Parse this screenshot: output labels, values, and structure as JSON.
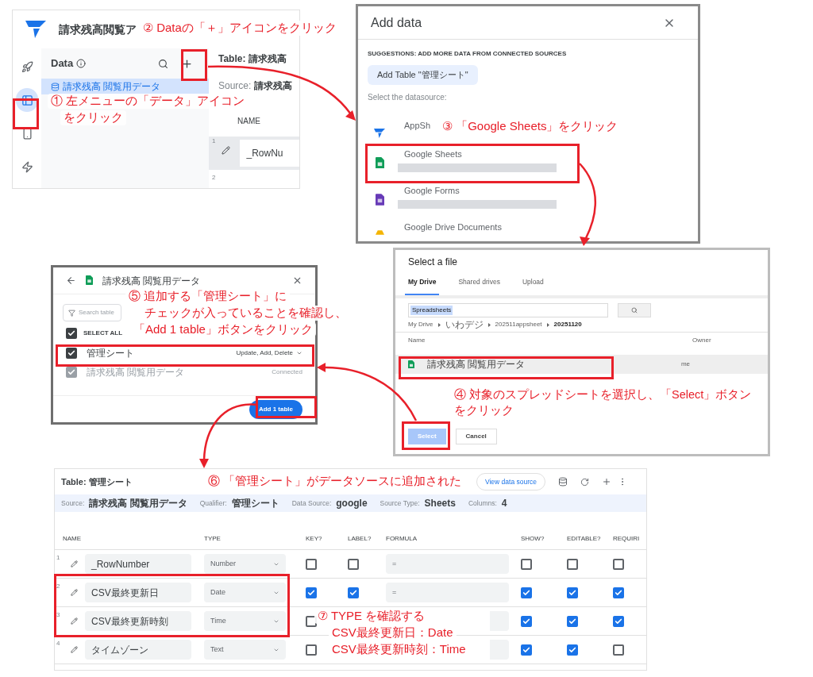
{
  "app_panel": {
    "title": "請求残高閲覧ア",
    "nav_items": [
      {
        "selected": false
      },
      {
        "selected": true
      },
      {
        "selected": false
      },
      {
        "selected": false
      }
    ],
    "data_heading": "Data",
    "data_items": [
      {
        "label": "請求残高 閲覧用データ",
        "selected": true
      }
    ],
    "table_title": "Table: 請求残高",
    "source_label": "Source:",
    "source_value": "請求残高",
    "column": "NAME",
    "rows": [
      {
        "number": "1",
        "name": "_RowNu"
      },
      {
        "number": "2"
      }
    ],
    "callouts": [
      {
        "lines": [
          "① 左メニューの「データ」アイコン",
          "をクリック"
        ]
      },
      {
        "lines": [
          "② Dataの「＋」アイコンをクリック"
        ]
      }
    ]
  },
  "add_data_dialog": {
    "title": "Add data",
    "suggestions_heading": "SUGGESTIONS: ADD MORE DATA FROM CONNECTED SOURCES",
    "suggestion_chip": "Add Table \"管理シート\"",
    "select_label": "Select the datasource:",
    "sources": [
      {
        "kind": "appsheet",
        "label": "AppSh"
      },
      {
        "kind": "sheets",
        "label": "Google Sheets"
      },
      {
        "kind": "forms",
        "label": "Google Forms"
      },
      {
        "kind": "docs",
        "label": "Google Drive Documents"
      }
    ],
    "callout": {
      "lines": [
        "③ 「Google Sheets」をクリック"
      ]
    }
  },
  "tables_dialog": {
    "title": "請求残高 閲覧用データ",
    "search_placeholder": "Search table",
    "select_all": {
      "label": "SELECT ALL",
      "checked": true
    },
    "tables": [
      {
        "name": "管理シート",
        "checked": true,
        "disabled": false,
        "access": "Update, Add, Delete"
      },
      {
        "name": "請求残高 閲覧用データ",
        "checked": true,
        "disabled": true,
        "access": "Connected"
      }
    ],
    "add_button": "Add 1 table",
    "callout": {
      "lines": [
        "⑤ 追加する「管理シート」に",
        "チェックが入っていることを確認し、",
        "「Add 1 table」ボタンをクリック"
      ]
    }
  },
  "file_picker": {
    "title": "Select a file",
    "tabs": [
      {
        "label": "My Drive",
        "selected": true
      },
      {
        "label": "Shared drives",
        "selected": false
      },
      {
        "label": "Upload",
        "selected": false
      }
    ],
    "search_value": "Spreadsheets",
    "breadcrumb": [
      "My Drive",
      "いわデジ",
      "202511appsheet",
      "20251120"
    ],
    "columns": [
      "Name",
      "Owner"
    ],
    "files": [
      {
        "name": "請求残高 閲覧用データ",
        "owner": "me",
        "selected": true
      }
    ],
    "buttons": [
      {
        "label": "Select",
        "disabled": true
      },
      {
        "label": "Cancel",
        "disabled": false
      }
    ],
    "callout": {
      "lines": [
        "④ 対象のスプレッドシートを選択し、「Select」ボタン",
        "をクリック"
      ]
    }
  },
  "table_editor": {
    "title": "Table: 管理シート",
    "view_button": "View data source",
    "info": [
      {
        "label": "Source:",
        "value": "請求残高 閲覧用データ"
      },
      {
        "label": "Qualifier:",
        "value": "管理シート"
      },
      {
        "label": "Data Source:",
        "value": "google"
      },
      {
        "label": "Source Type:",
        "value": "Sheets"
      },
      {
        "label": "Columns:",
        "value": "4"
      }
    ],
    "columns": [
      "NAME",
      "TYPE",
      "KEY?",
      "LABEL?",
      "FORMULA",
      "SHOW?",
      "EDITABLE?",
      "REQUIRI"
    ],
    "rows": [
      {
        "number": "1",
        "name": "_RowNumber",
        "type": "Number",
        "key": false,
        "label": false,
        "formula": "=",
        "show": false,
        "editable": false,
        "required": false
      },
      {
        "number": "2",
        "name": "CSV最終更新日",
        "type": "Date",
        "key": true,
        "label": true,
        "formula": "=",
        "show": true,
        "editable": true,
        "required": true
      },
      {
        "number": "3",
        "name": "CSV最終更新時刻",
        "type": "Time",
        "key": false,
        "show": true,
        "editable": true,
        "required": true
      },
      {
        "number": "4",
        "name": "タイムゾーン",
        "type": "Text",
        "key": false,
        "show": true,
        "editable": true,
        "required": false
      }
    ],
    "callouts": [
      {
        "lines": [
          "⑥ 「管理シート」がデータソースに追加された"
        ]
      },
      {
        "lines": [
          "⑦ TYPE を確認する",
          "CSV最終更新日：Date",
          "CSV最終更新時刻：Time"
        ]
      }
    ]
  }
}
